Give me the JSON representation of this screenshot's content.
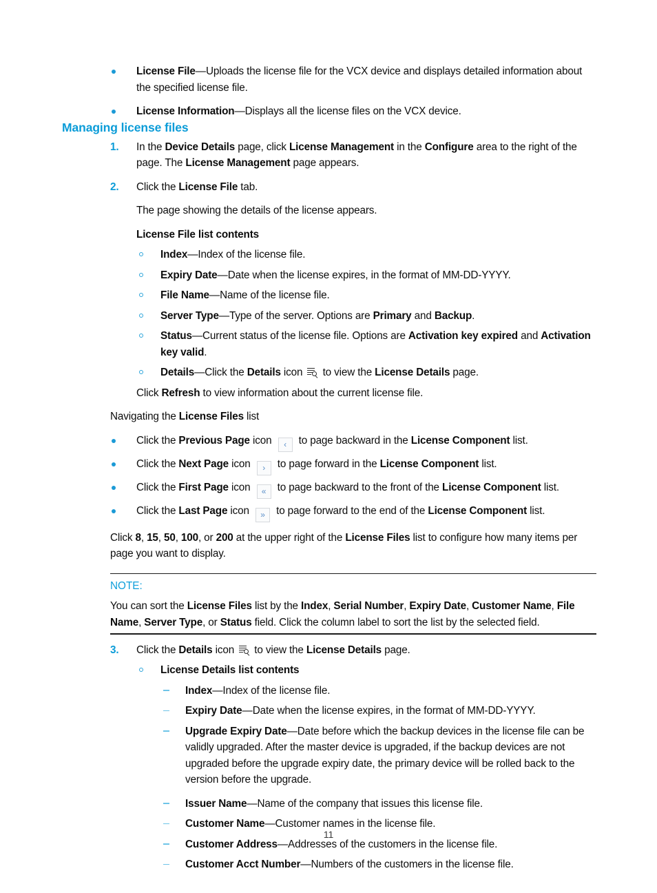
{
  "page": {
    "folio": "11"
  },
  "intro_bullets": [
    {
      "term": "License File",
      "dash": "—",
      "text": "Uploads the license file for the VCX device and displays detailed information about the specified license file."
    },
    {
      "term": "License Information",
      "dash": "—",
      "text": "Displays all the license files on the VCX device."
    }
  ],
  "section": {
    "heading": "Managing license files"
  },
  "steps": {
    "step1": {
      "num": "1.",
      "part1": "In the ",
      "bold1": "Device Details",
      "part2": " page, click ",
      "bold2": "License Management",
      "part3": " in the ",
      "bold3": "Configure",
      "part4": " area to the right of the page. The ",
      "bold4": "License Management",
      "part5": " page appears."
    },
    "step2": {
      "num": "2.",
      "part1": "Click the ",
      "bold1": "License File",
      "part2": " tab.",
      "followup": "The page showing the details of the license appears."
    },
    "step3": {
      "num": "3.",
      "part1": "Click the ",
      "bold1": "Details",
      "part2": " icon ",
      "icon": "details-icon",
      "part3": " to view the ",
      "bold2": "License Details",
      "part4": " page."
    }
  },
  "license_file_list": {
    "title": "License File list contents",
    "items": [
      {
        "term": "Index",
        "dash": "—",
        "text": "Index of the license file."
      },
      {
        "term": "Expiry Date",
        "dash": "—",
        "text": "Date when the license expires, in the format of MM-DD-YYYY."
      },
      {
        "term": "File Name",
        "dash": "—",
        "text": "Name of the license file."
      }
    ],
    "server_type": {
      "term": "Server Type",
      "dash": "—",
      "part1": "Type of the server. Options are ",
      "bold1": "Primary",
      "part2": " and ",
      "bold2": "Backup",
      "part3": "."
    },
    "status": {
      "term": "Status",
      "dash": "—",
      "part1": "Current status of the license file. Options are ",
      "bold1": "Activation key expired",
      "part2": " and ",
      "bold2": "Activation key valid",
      "part3": "."
    },
    "details": {
      "term": "Details",
      "dash": "—",
      "part1": "Click the ",
      "bold1": "Details",
      "part2": " icon ",
      "icon": "details-icon",
      "part3": " to view the ",
      "bold2": "License Details",
      "part4": " page."
    },
    "refresh_note": {
      "part1": "Click ",
      "bold1": "Refresh",
      "part2": " to view information about the current license file."
    }
  },
  "navigation": {
    "intro": {
      "part1": "Navigating the ",
      "bold1": "License Files",
      "part2": " list"
    },
    "items": [
      {
        "part1": "Click the ",
        "bold1": "Previous Page",
        "part2": " icon ",
        "icon_glyph": "‹",
        "icon_name": "previous-page-icon",
        "part3": " to page backward in the ",
        "bold2": "License Component",
        "part4": " list."
      },
      {
        "part1": "Click the ",
        "bold1": "Next Page",
        "part2": " icon ",
        "icon_glyph": "›",
        "icon_name": "next-page-icon",
        "part3": " to page forward in the ",
        "bold2": "License Component",
        "part4": " list."
      },
      {
        "part1": "Click the ",
        "bold1": "First Page",
        "part2": " icon ",
        "icon_glyph": "«",
        "icon_name": "first-page-icon",
        "part3": " to page backward to the front of the ",
        "bold2": "License Component",
        "part4": " list."
      },
      {
        "part1": "Click the ",
        "bold1": "Last Page",
        "part2": " icon ",
        "icon_glyph": "»",
        "icon_name": "last-page-icon",
        "part3": " to page forward to the end of the ",
        "bold2": "License Component",
        "part4": " list."
      }
    ],
    "page_size": {
      "part1": "Click ",
      "opt1": "8",
      "sep1": ", ",
      "opt2": "15",
      "sep2": ", ",
      "opt3": "50",
      "sep3": ", ",
      "opt4": "100",
      "sep4": ", or ",
      "opt5": "200",
      "part2": " at the upper right of the ",
      "bold1": "License Files",
      "part3": " list to configure how many items per page you want to display."
    }
  },
  "note": {
    "label": "NOTE:",
    "part1": "You can sort the ",
    "bold1": "License Files",
    "part2": " list by the ",
    "bold2": "Index",
    "sep1": ", ",
    "bold3": "Serial Number",
    "sep2": ", ",
    "bold4": "Expiry Date",
    "sep3": ", ",
    "bold5": "Customer Name",
    "sep4": ", ",
    "bold6": "File Name",
    "sep5": ", ",
    "bold7": "Server Type",
    "sep6": ", or ",
    "bold8": "Status",
    "part3": " field. Click the column label to sort the list by the selected field."
  },
  "license_details_list": {
    "title": "License Details list contents",
    "items": [
      {
        "term": "Index",
        "dash": "—",
        "text": "Index of the license file."
      },
      {
        "term": "Expiry Date",
        "dash": "—",
        "text": "Date when the license expires, in the format of MM-DD-YYYY."
      },
      {
        "term": "Upgrade Expiry Date",
        "dash": "—",
        "text": "Date before which the backup devices in the license file can be validly upgraded. After the master device is upgraded, if the backup devices are not upgraded before the upgrade expiry date, the primary device will be rolled back to the version before the upgrade."
      },
      {
        "term": "Issuer Name",
        "dash": "—",
        "text": "Name of the company that issues this license file."
      },
      {
        "term": "Customer Name",
        "dash": "—",
        "text": "Customer names in the license file."
      },
      {
        "term": "Customer Address",
        "dash": "—",
        "text": "Addresses of the customers in the license file."
      },
      {
        "term": "Customer Acct Number",
        "dash": "—",
        "text": "Numbers of the customers in the license file."
      }
    ]
  }
}
